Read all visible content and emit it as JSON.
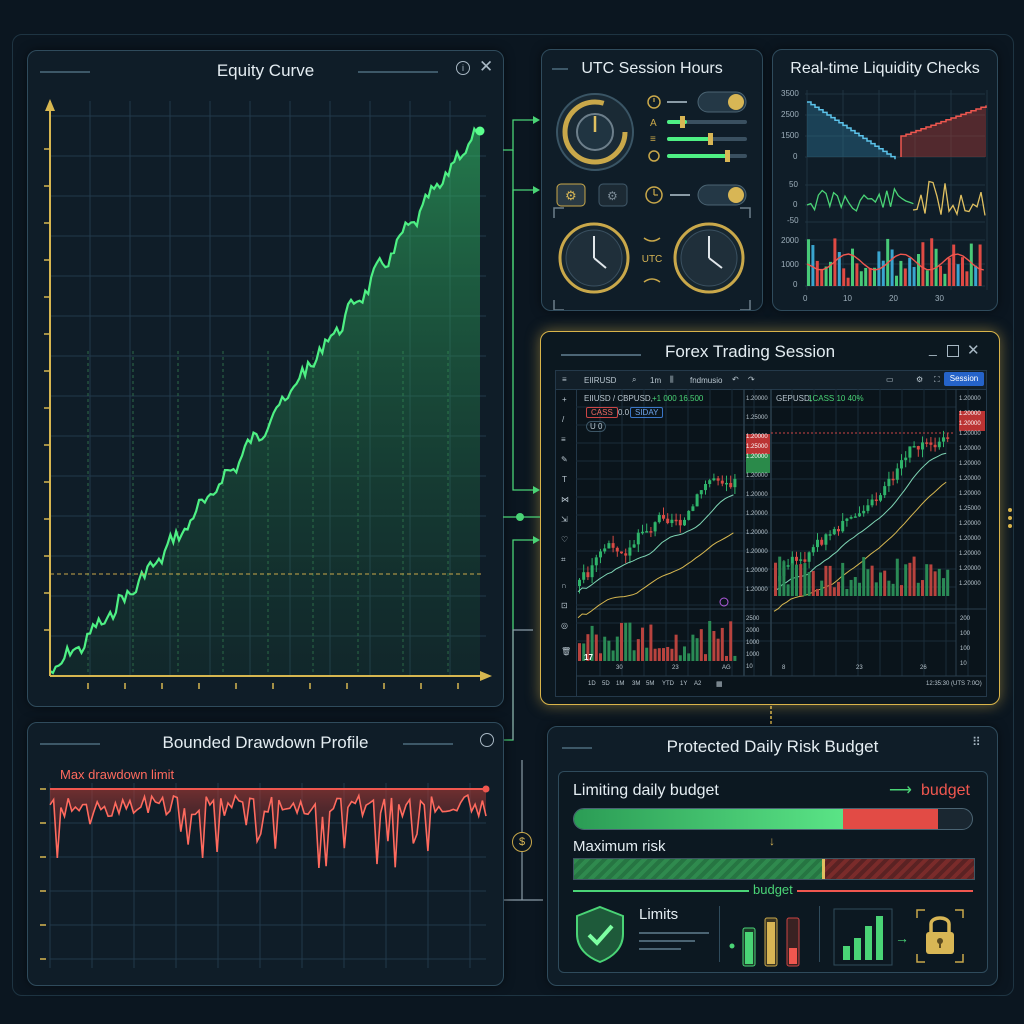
{
  "equity": {
    "title": "Equity Curve",
    "info_icon": "info-icon",
    "close_icon": "close-icon",
    "color": "#3ddc6a"
  },
  "utc": {
    "title": "UTC Session Hours",
    "center_label": "UTC"
  },
  "liquidity": {
    "title": "Real-time Liquidity Checks",
    "top_ticks": [
      "3500",
      "2500",
      "1500",
      "0"
    ],
    "mid_ticks": [
      "50",
      "0",
      "-50"
    ],
    "bottom_ticks": [
      "2000",
      "1000",
      "0"
    ],
    "x_ticks": [
      "0",
      "10",
      "20",
      "30"
    ]
  },
  "forex": {
    "title": "Forex Trading Session",
    "symbol": "EIIRUSD",
    "timeframe": "1m",
    "indicators": "fndmusio",
    "session_button": "Session",
    "left_chart": {
      "header": "EIIUSD / CBPUSD,",
      "header_detail": "+1 000 16.500",
      "sell_badge": "CASS",
      "mid_value": "0.0",
      "buy_badge": "SIDAY",
      "badge_small": "U 0",
      "price_ticks": [
        "1.20000",
        "1.25000",
        "1.20000",
        "1.25000",
        "1.20000",
        "1.20000",
        "1.20000",
        "1.20000",
        "1.20000",
        "1.20000",
        "1.20000",
        "1.20000"
      ],
      "vol_ticks": [
        "2500",
        "2000",
        "1000",
        "1000",
        "10"
      ],
      "x_ticks": [
        "30",
        "23",
        "AG"
      ]
    },
    "right_chart": {
      "header": "GEPUSD,",
      "header_detail": "1CASS 10 40%",
      "price_ticks": [
        "1.20000",
        "1.20000",
        "1.20000",
        "1.20000",
        "1.20000",
        "1.20000",
        "1.20000",
        "1.20000",
        "1.25000",
        "1.20000",
        "1.20000",
        "1.20000",
        "1.20000",
        "1.20000"
      ],
      "vol_ticks": [
        "200",
        "100",
        "100",
        "10"
      ],
      "x_ticks": [
        "8",
        "23",
        "26"
      ]
    },
    "range_buttons": [
      "1D",
      "5D",
      "1M",
      "3M",
      "5M",
      "YTD",
      "1Y",
      "A2"
    ],
    "clock_text": "12:35:30 (UTS 7:0O)"
  },
  "drawdown": {
    "title": "Bounded Drawdown Profile",
    "limit_label": "Max drawdown limit",
    "color": "#e0524b"
  },
  "risk": {
    "title": "Protected Daily Risk Budget",
    "limiting_label": "Limiting daily budget",
    "budget_tag": "budget",
    "limiting_fill": 0.9,
    "maximum_label": "Maximum risk",
    "maximum_fill": 0.62,
    "budget_label": "budget",
    "limits_label": "Limits",
    "dollar_icon": "dollar-icon",
    "shield_icon": "shield-check-icon",
    "lock_icon": "padlock-icon"
  }
}
